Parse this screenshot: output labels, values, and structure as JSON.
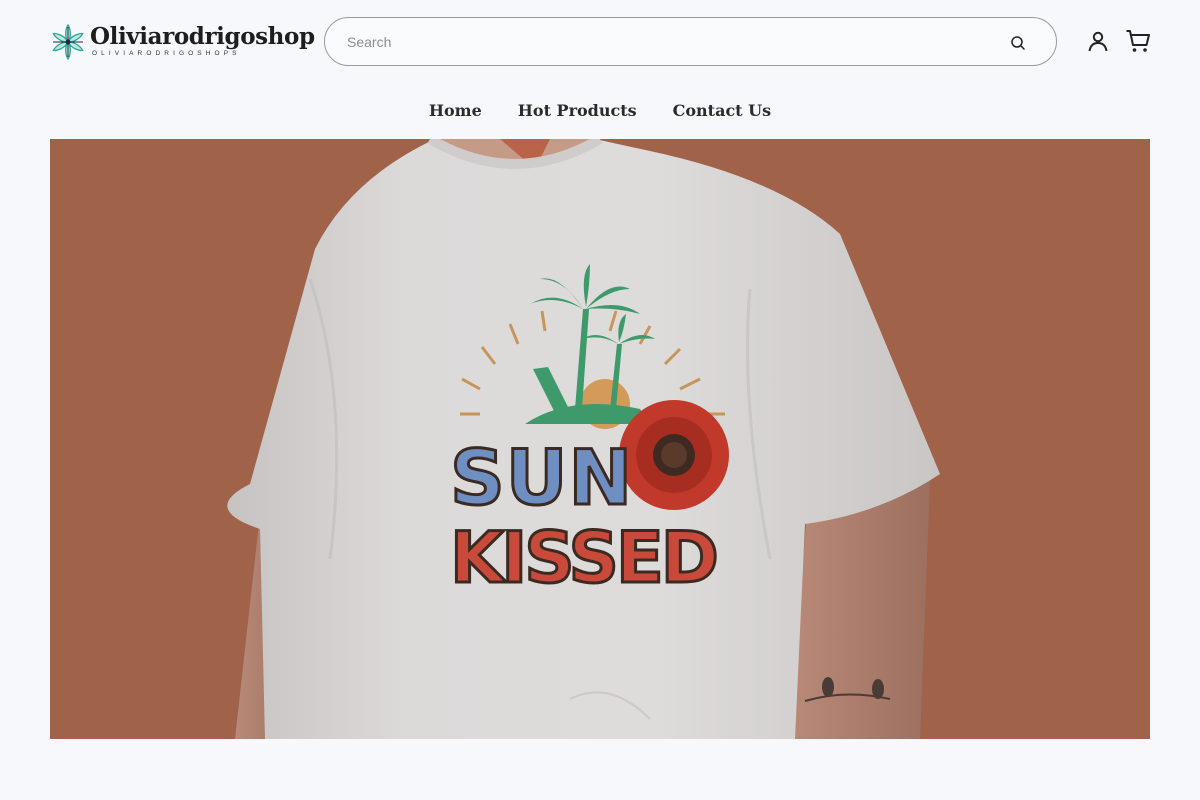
{
  "logo": {
    "title": "Oliviarodrigoshop",
    "subtitle": "OLIVIARODRIGOSHOPS",
    "icon": "flower-logo-icon"
  },
  "search": {
    "placeholder": "Search",
    "value": "",
    "button_icon": "search-icon"
  },
  "header_icons": {
    "account": "account-icon",
    "cart": "cart-icon"
  },
  "nav": {
    "items": [
      "Home",
      "Hot Products",
      "Contact Us"
    ]
  },
  "hero": {
    "print_line1": "SUN",
    "print_line2": "KISSED",
    "background": "#a0634a",
    "shirt_color": "#d9d7d6"
  },
  "colors": {
    "page_bg": "#f7f8fb",
    "text": "#2b2b2b",
    "logo_accent": "#3bb6a6"
  }
}
